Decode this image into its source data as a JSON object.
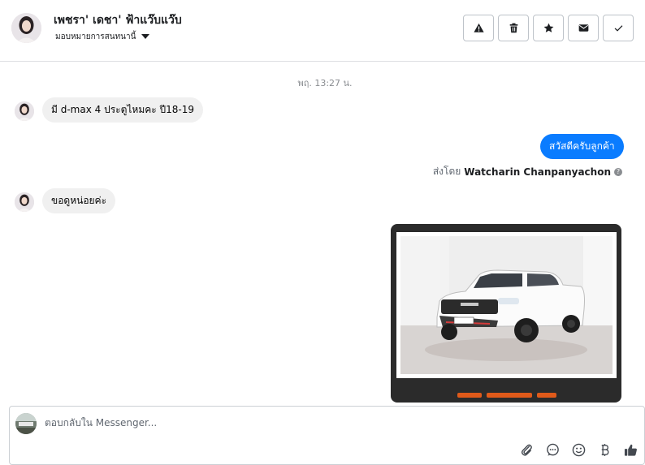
{
  "header": {
    "contact_name": "เพชรา' เดชา' ฟ้าแว๊บแว๊บ",
    "assign_label": "มอบหมายการสนทนานี้",
    "actions": [
      {
        "icon": "warning-icon",
        "name": "mark-spam-button"
      },
      {
        "icon": "trash-icon",
        "name": "delete-button"
      },
      {
        "icon": "star-icon",
        "name": "star-button"
      },
      {
        "icon": "envelope-icon",
        "name": "mark-unread-button"
      },
      {
        "icon": "check-icon",
        "name": "mark-done-button"
      }
    ]
  },
  "conversation": {
    "timestamp": "พฤ. 13:27 น.",
    "messages": [
      {
        "direction": "incoming",
        "text": "มี d-max 4 ประตูไหมคะ ปี18-19"
      },
      {
        "direction": "outgoing",
        "text": "สวัสดีครับลูกค้า"
      },
      {
        "direction": "incoming",
        "text": "ขอดูหน่อยค่ะ"
      }
    ],
    "sent_by_prefix": "ส่งโดย",
    "sent_by_name": "Watcharin Chanpanyachon",
    "help_icon": "?"
  },
  "composer": {
    "placeholder": "ตอบกลับใน Messenger...",
    "tools": [
      "attachment-icon",
      "chat-bubble-icon",
      "emoji-icon",
      "baht-icon",
      "thumbs-up-icon"
    ]
  },
  "colors": {
    "outgoing_bubble": "#0a7cff",
    "incoming_bubble": "#f0f0f0",
    "border": "#dddfe2"
  }
}
